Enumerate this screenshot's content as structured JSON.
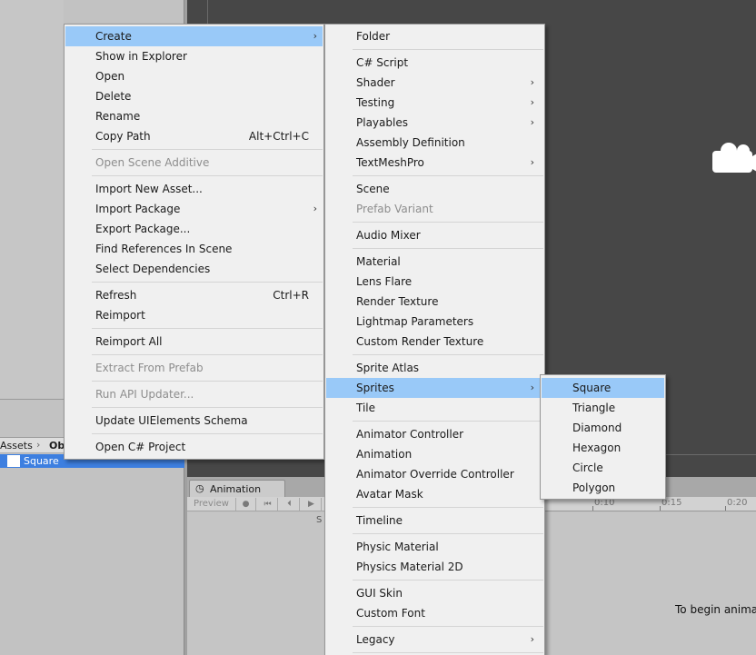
{
  "background": {
    "project_breadcrumb": {
      "root": "Assets",
      "folder": "Ob"
    },
    "selected_asset": "Square",
    "animation_tab": "Animation",
    "animation_toolbar": {
      "preview": "Preview",
      "cut_label": "S"
    },
    "timeline_ticks": [
      "0:10",
      "0:15",
      "0:20"
    ],
    "animation_message": "To begin anima"
  },
  "menu_main": {
    "items": [
      {
        "label": "Create",
        "submenu": true,
        "highlighted": true
      },
      {
        "label": "Show in Explorer"
      },
      {
        "label": "Open"
      },
      {
        "label": "Delete"
      },
      {
        "label": "Rename"
      },
      {
        "label": "Copy Path",
        "shortcut": "Alt+Ctrl+C"
      },
      {
        "label": "Open Scene Additive",
        "disabled": true
      },
      {
        "label": "Import New Asset..."
      },
      {
        "label": "Import Package",
        "submenu": true
      },
      {
        "label": "Export Package..."
      },
      {
        "label": "Find References In Scene"
      },
      {
        "label": "Select Dependencies"
      },
      {
        "label": "Refresh",
        "shortcut": "Ctrl+R"
      },
      {
        "label": "Reimport"
      },
      {
        "label": "Reimport All"
      },
      {
        "label": "Extract From Prefab",
        "disabled": true
      },
      {
        "label": "Run API Updater...",
        "disabled": true
      },
      {
        "label": "Update UIElements Schema"
      },
      {
        "label": "Open C# Project"
      }
    ]
  },
  "menu_create": {
    "items": [
      {
        "label": "Folder"
      },
      {
        "label": "C# Script"
      },
      {
        "label": "Shader",
        "submenu": true
      },
      {
        "label": "Testing",
        "submenu": true
      },
      {
        "label": "Playables",
        "submenu": true
      },
      {
        "label": "Assembly Definition"
      },
      {
        "label": "TextMeshPro",
        "submenu": true
      },
      {
        "label": "Scene"
      },
      {
        "label": "Prefab Variant",
        "disabled": true
      },
      {
        "label": "Audio Mixer"
      },
      {
        "label": "Material"
      },
      {
        "label": "Lens Flare"
      },
      {
        "label": "Render Texture"
      },
      {
        "label": "Lightmap Parameters"
      },
      {
        "label": "Custom Render Texture"
      },
      {
        "label": "Sprite Atlas"
      },
      {
        "label": "Sprites",
        "submenu": true,
        "highlighted": true
      },
      {
        "label": "Tile"
      },
      {
        "label": "Animator Controller"
      },
      {
        "label": "Animation"
      },
      {
        "label": "Animator Override Controller"
      },
      {
        "label": "Avatar Mask"
      },
      {
        "label": "Timeline"
      },
      {
        "label": "Physic Material"
      },
      {
        "label": "Physics Material 2D"
      },
      {
        "label": "GUI Skin"
      },
      {
        "label": "Custom Font"
      },
      {
        "label": "Legacy",
        "submenu": true
      }
    ]
  },
  "menu_sprites": {
    "items": [
      {
        "label": "Square",
        "highlighted": true
      },
      {
        "label": "Triangle"
      },
      {
        "label": "Diamond"
      },
      {
        "label": "Hexagon"
      },
      {
        "label": "Circle"
      },
      {
        "label": "Polygon"
      }
    ]
  },
  "colors": {
    "menu_bg": "#f0f0f0",
    "menu_highlight": "#99c9f8",
    "disabled_text": "#8d8d8d",
    "scene_bg": "#474747",
    "selection_blue": "#3d7fe0"
  }
}
